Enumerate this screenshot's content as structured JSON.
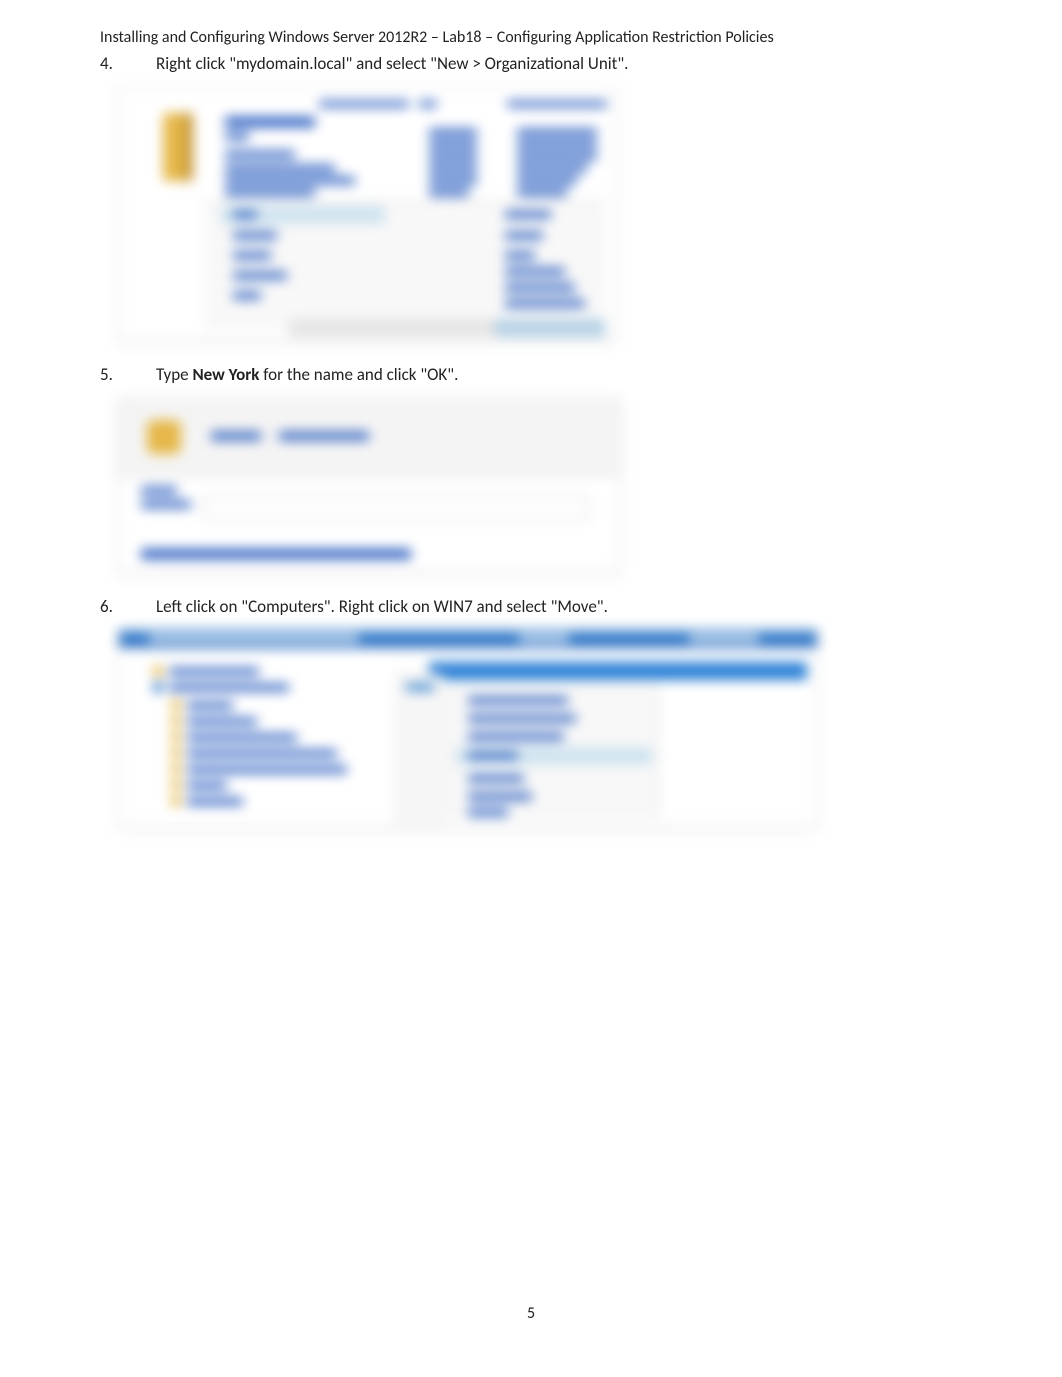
{
  "header": "Installing and Configuring Windows Server 2012R2 – Lab18 – Configuring Application Restriction Policies",
  "steps": {
    "s4": {
      "num": "4.",
      "text_before": "Right click \"mydomain.local\" and select \"New > Organizational Unit\"."
    },
    "s5": {
      "num": "5.",
      "text_before": "Type ",
      "bold": "New York",
      "text_after": " for the name and click \"OK\"."
    },
    "s6": {
      "num": "6.",
      "text_before": "Left click on \"Computers\". Right click on WIN7 and select \"Move\"."
    }
  },
  "page_number": "5"
}
